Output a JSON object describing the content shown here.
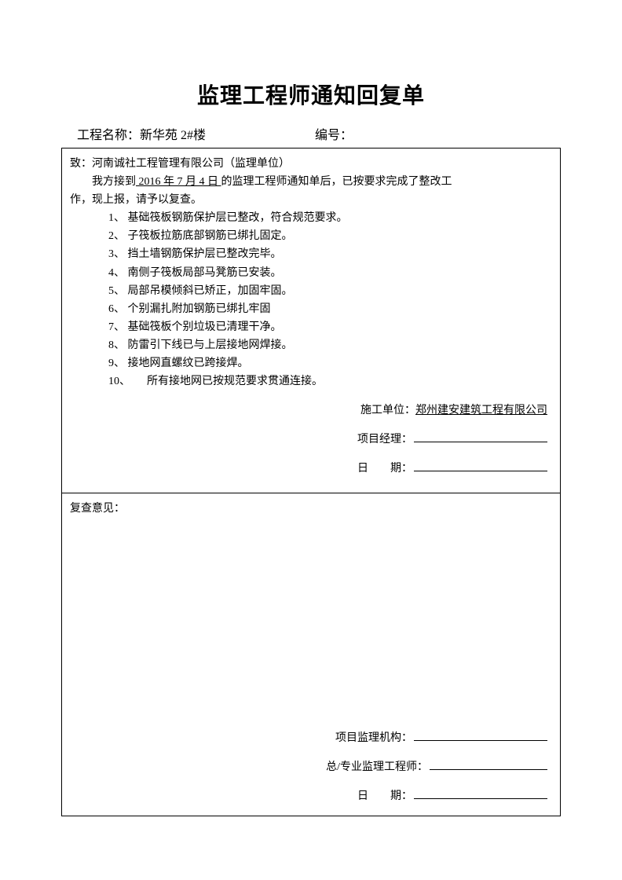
{
  "title": "监理工程师通知回复单",
  "header": {
    "project_label": "工程名称：",
    "project_value": "新华苑 2#楼",
    "number_label": "编号："
  },
  "top": {
    "to_line_prefix": "致：",
    "to_line_company": "河南诚社工程管理有限公司（监理单位）",
    "receipt_prefix": "我方接到",
    "receipt_date": " 2016 年 7 月 4 日 ",
    "receipt_suffix": "的监理工程师通知单后，已按要求完成了整改工",
    "receipt_line2": "作，现上报，请予以复查。",
    "items": [
      "1、 基础筏板钢筋保护层已整改，符合规范要求。",
      "2、 子筏板拉筋底部钢筋已绑扎固定。",
      "3、 挡土墙钢筋保护层已整改完毕。",
      "4、 南侧子筏板局部马凳筋已安装。",
      "5、 局部吊模倾斜已矫正，加固牢固。",
      "6、 个别漏扎附加钢筋已绑扎牢固",
      "7、 基础筏板个别垃圾已清理干净。",
      "8、 防雷引下线已与上层接地网焊接。",
      "9、 接地网直螺纹已跨接焊。",
      "10、　　所有接地网已按规范要求贯通连接。"
    ],
    "sig_unit_label": "施工单位：",
    "sig_unit_value": "郑州建安建筑工程有限公司",
    "sig_pm_label": "项目经理：",
    "sig_date_label": "日　　期："
  },
  "bottom": {
    "review_label": "复查意见：",
    "sig_org_label": "项目监理机构：",
    "sig_eng_label": "总/专业监理工程师：",
    "sig_date_label": "日　　期："
  }
}
